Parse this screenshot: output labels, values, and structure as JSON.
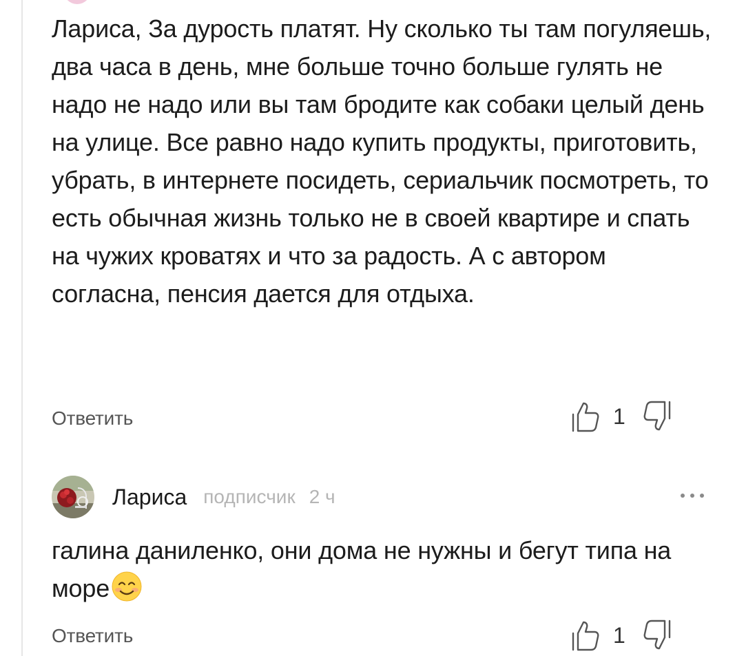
{
  "thread": {
    "comments": [
      {
        "text": "Лариса, За дурость платят. Ну сколько ты там погуляешь, два часа в день, мне больше точно больше гулять не надо не надо или вы там бродите как собаки целый день на улице. Все равно надо купить продукты, приготовить, убрать, в интернете посидеть, сериальчик посмотреть, то есть обычная жизнь только не в своей квартире и спать на чужих кроватях и что за радость. А с автором согласна, пенсия дается для отдыха.",
        "reply_label": "Ответить",
        "likes": "1"
      },
      {
        "author": "Лариса",
        "badge": "подписчик",
        "time": "2 ч",
        "text": "галина даниленко, они дома не нужны и бегут типа на море",
        "emoji_icon": "smiling-face-emoji",
        "reply_label": "Ответить",
        "likes": "1"
      }
    ]
  },
  "colors": {
    "text": "#1c1c1c",
    "muted": "#b5b5b5",
    "reply": "#555555",
    "thread_line": "#e6e6e6"
  }
}
